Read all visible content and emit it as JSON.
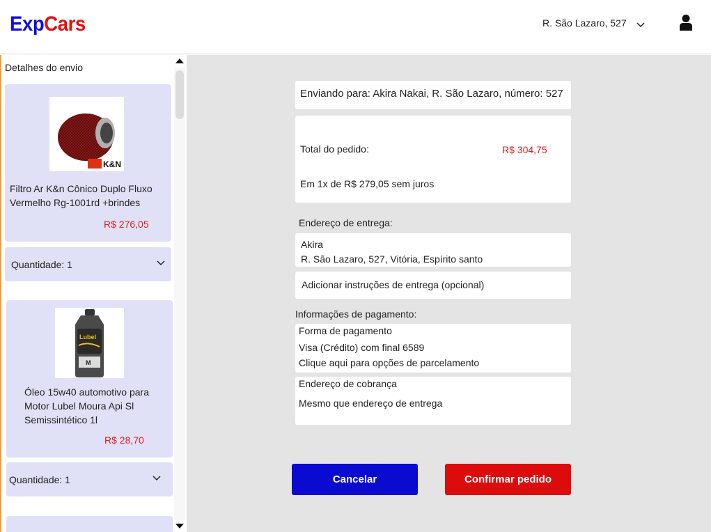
{
  "header": {
    "logo_part1": "Exp",
    "logo_part2": "Cars",
    "address": "R. São Lazaro, 527"
  },
  "sidebar": {
    "title": "Detalhes do envio",
    "products": [
      {
        "name_line1": "Filtro Ar K&n Cônico Duplo Fluxo",
        "name_line2": "Vermelho Rg-1001rd +brindes",
        "price": "R$ 276,05",
        "quantity_label": "Quantidade: 1"
      },
      {
        "name_line1": "Óleo 15w40 automotivo para",
        "name_line2": "Motor Lubel Moura Api Sl",
        "name_line3": "Semissintético 1l",
        "price": "R$ 28,70",
        "quantity_label": "Quantidade: 1"
      }
    ]
  },
  "main": {
    "shipping_to": "Enviando para: Akira Nakai, R. São Lazaro, número: 527",
    "total_label": "Total do pedido:",
    "total_value": "R$ 304,75",
    "installments": "Em 1x de R$ 279,05 sem juros",
    "delivery_heading": "Endereço de entrega:",
    "delivery_name": "Akira",
    "delivery_address": "R. São Lazaro, 527, Vitória, Espírito santo",
    "delivery_instructions": "Adicionar instruções de entrega (opcional)",
    "payment_heading": "Informações de pagamento:",
    "payment_method_label": "Forma de pagamento",
    "payment_card": "Visa (Crédito) com final 6589",
    "payment_installments_link": "Clique aqui para opções de parcelamento",
    "billing_label": "Endereço de cobrança",
    "billing_value": "Mesmo que endereço de entrega"
  },
  "buttons": {
    "cancel": "Cancelar",
    "confirm": "Confirmar pedido"
  },
  "colors": {
    "brand_blue": "#1010d8",
    "brand_red": "#e01010",
    "cancel_button": "#0a0ad0",
    "confirm_button": "#dd0c0c",
    "price_red": "#e02020"
  }
}
